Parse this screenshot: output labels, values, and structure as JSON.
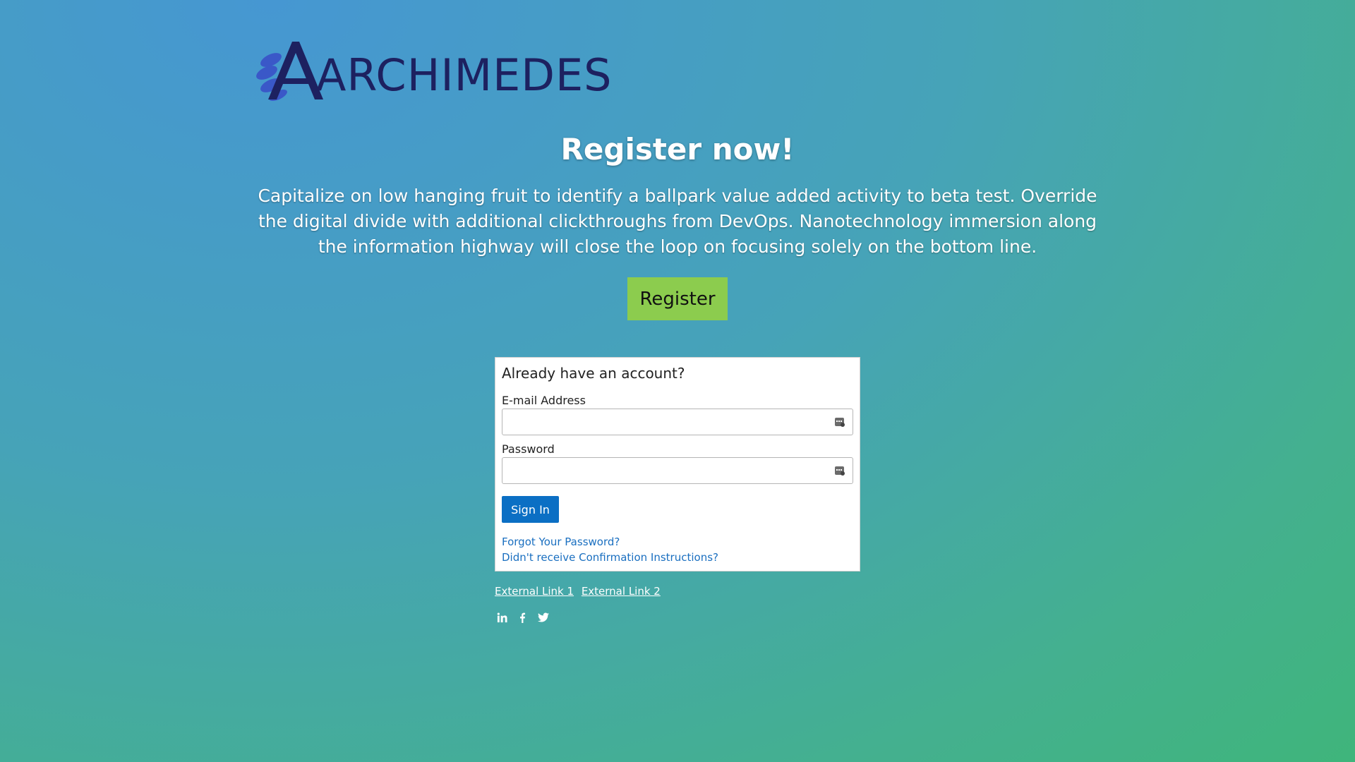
{
  "brand": {
    "logo_text": "ARCHIMEDES",
    "logo_color": "#1d2160",
    "logo_accent": "#3a58c8"
  },
  "hero": {
    "title": "Register now!",
    "description": "Capitalize on low hanging fruit to identify a ballpark value added activity to beta test. Override the digital divide with additional clickthroughs from DevOps. Nanotechnology immersion along the information highway will close the loop on focusing solely on the bottom line.",
    "register_label": "Register",
    "register_color": "#8ccc4e"
  },
  "login": {
    "title": "Already have an account?",
    "email_label": "E-mail Address",
    "email_value": "",
    "password_label": "Password",
    "password_value": "",
    "signin_label": "Sign In",
    "signin_color": "#0b6fc4",
    "forgot_label": "Forgot Your Password?",
    "confirm_label": "Didn't receive Confirmation Instructions?"
  },
  "footer": {
    "links": [
      "External Link 1",
      "External Link 2"
    ],
    "social": [
      "linkedin-icon",
      "facebook-icon",
      "twitter-icon"
    ]
  }
}
